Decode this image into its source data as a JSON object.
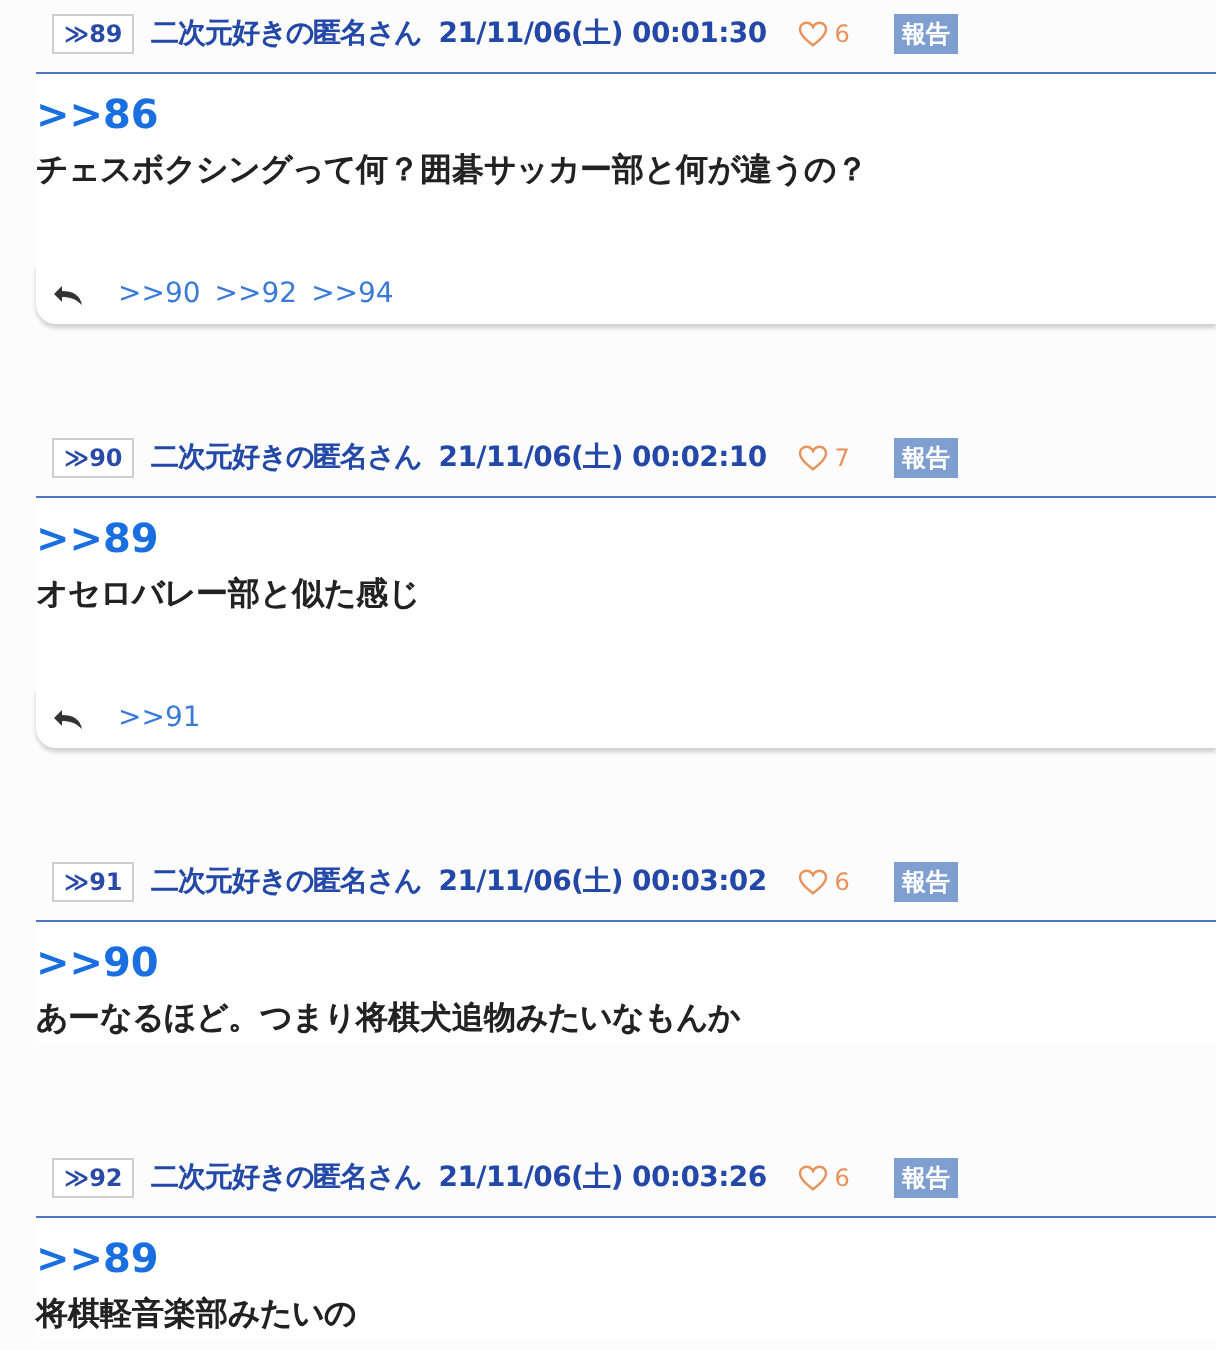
{
  "posts": [
    {
      "number": "≫89",
      "name": "二次元好きの匿名さん",
      "date": "21/11/06(土) 00:01:30",
      "likes": "6",
      "report": "報告",
      "anchor": ">>86",
      "body": "チェスボクシングって何？囲碁サッカー部と何が違うの？",
      "replies": [
        ">>90",
        ">>92",
        ">>94"
      ]
    },
    {
      "number": "≫90",
      "name": "二次元好きの匿名さん",
      "date": "21/11/06(土) 00:02:10",
      "likes": "7",
      "report": "報告",
      "anchor": ">>89",
      "body": "オセロバレー部と似た感じ",
      "replies": [
        ">>91"
      ]
    },
    {
      "number": "≫91",
      "name": "二次元好きの匿名さん",
      "date": "21/11/06(土) 00:03:02",
      "likes": "6",
      "report": "報告",
      "anchor": ">>90",
      "body": "あーなるほど。つまり将棋犬追物みたいなもんか"
    },
    {
      "number": "≫92",
      "name": "二次元好きの匿名さん",
      "date": "21/11/06(土) 00:03:26",
      "likes": "6",
      "report": "報告",
      "anchor": ">>89",
      "body": "将棋軽音楽部みたいの"
    }
  ]
}
